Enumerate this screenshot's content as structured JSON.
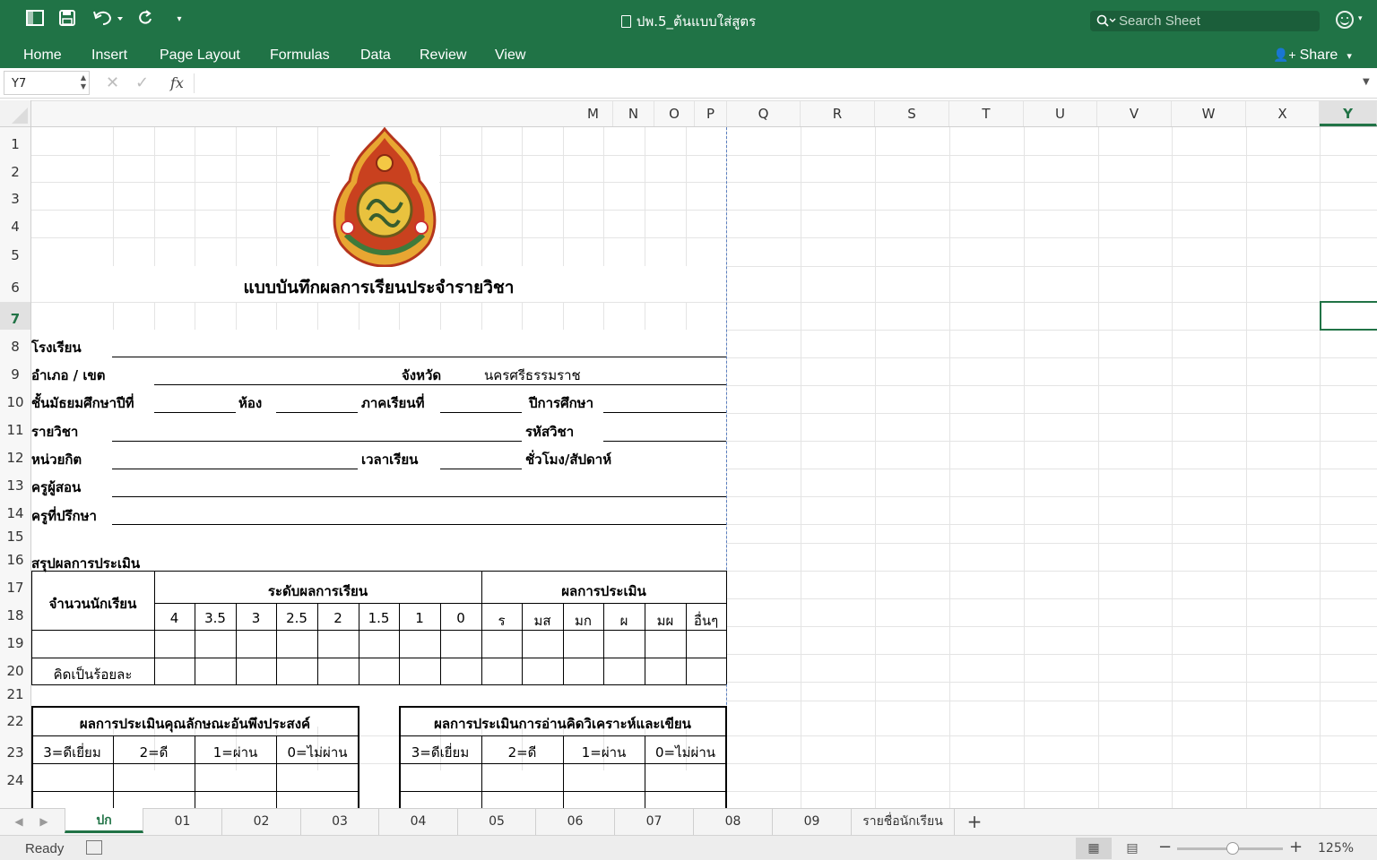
{
  "window": {
    "title": "ปพ.5_ต้นแบบใส่สูตร",
    "search_placeholder": "Search Sheet",
    "share_label": "Share"
  },
  "icons": {
    "sidebar": "sidebar-toggle-icon",
    "save": "save-icon",
    "undo": "undo-icon",
    "redo": "redo-icon",
    "customize": "customize-toolbar-icon",
    "search": "search-icon",
    "smiley": "feedback-smiley-icon"
  },
  "ribbon": {
    "tabs": [
      "Home",
      "Insert",
      "Page Layout",
      "Formulas",
      "Data",
      "Review",
      "View"
    ]
  },
  "formula_bar": {
    "name_box": "Y7",
    "fx": "fx",
    "value": ""
  },
  "columns": [
    "M",
    "N",
    "O",
    "P",
    "Q",
    "R",
    "S",
    "T",
    "U",
    "V",
    "W",
    "X",
    "Y"
  ],
  "rows": [
    "1",
    "2",
    "3",
    "4",
    "5",
    "6",
    "7",
    "8",
    "9",
    "10",
    "11",
    "12",
    "13",
    "14",
    "15",
    "16",
    "17",
    "18",
    "19",
    "20",
    "21",
    "22",
    "23",
    "24"
  ],
  "selected": {
    "column": "Y",
    "row": "7"
  },
  "sheet": {
    "title": "แบบบันทึกผลการเรียนประจำรายวิชา",
    "school_label": "โรงเรียน",
    "district_label": "อำเภอ / เขต",
    "province_label": "จังหวัด",
    "province_value": "นครศรีธรรมราช",
    "grade_label": "ชั้นมัธยมศึกษาปีที่",
    "room_label": "ห้อง",
    "semester_label": "ภาคเรียนที่",
    "year_label": "ปีการศึกษา",
    "subject_label": "รายวิชา",
    "code_label": "รหัสวิชา",
    "credit_label": "หน่วยกิต",
    "time_label": "เวลาเรียน",
    "hours_label": "ชั่วโมง/สัปดาห์",
    "teacher_label": "ครูผู้สอน",
    "advisor_label": "ครูที่ปรึกษา",
    "summary_label": "สรุปผลการประเมิน",
    "students_label": "จำนวนนักเรียน",
    "level_label": "ระดับผลการเรียน",
    "eval_label": "ผลการประเมิน",
    "grades": [
      "4",
      "3.5",
      "3",
      "2.5",
      "2",
      "1.5",
      "1",
      "0"
    ],
    "evals": [
      "ร",
      "มส",
      "มก",
      "ผ",
      "มผ",
      "อื่นๆ"
    ],
    "percent_label": "คิดเป็นร้อยละ",
    "trait_title": "ผลการประเมินคุณลักษณะอันพึงประสงค์",
    "reading_title": "ผลการประเมินการอ่านคิดวิเคราะห์และเขียน",
    "scale": [
      "3=ดีเยี่ยม",
      "2=ดี",
      "1=ผ่าน",
      "0=ไม่ผ่าน"
    ]
  },
  "sheet_tabs": [
    "ปก",
    "01",
    "02",
    "03",
    "04",
    "05",
    "06",
    "07",
    "08",
    "09",
    "รายชื่อนักเรียน"
  ],
  "active_sheet": "ปก",
  "status": {
    "text": "Ready",
    "zoom": "125%"
  },
  "colors": {
    "accent": "#217346",
    "titlebar": "#207346"
  }
}
